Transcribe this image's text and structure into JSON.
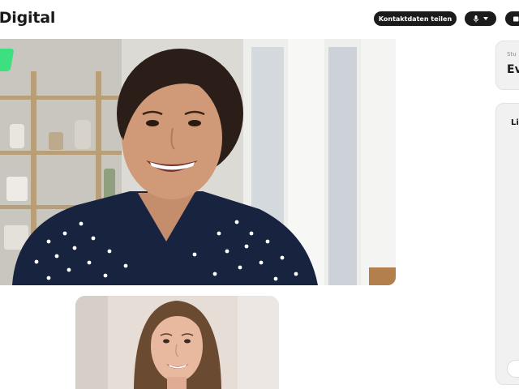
{
  "header": {
    "app_title": "i Digital",
    "contact_button_label": "Kontaktdaten teilen",
    "mic_icon": "microphone-icon",
    "dropdown_icon": "caret-down-icon"
  },
  "info_card": {
    "label": "Stu",
    "value": "Ev"
  },
  "side_panel": {
    "title": "Li"
  },
  "colors": {
    "accent": "#3ce07e",
    "button_bg": "#1b1b1b",
    "panel_bg": "#f1f1f1"
  }
}
